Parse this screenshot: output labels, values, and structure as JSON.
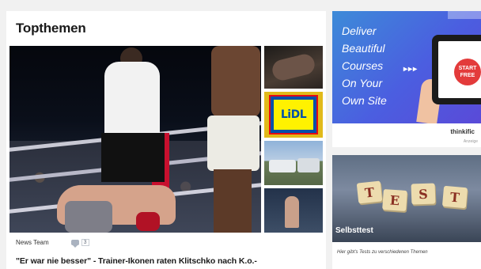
{
  "topthemen": {
    "title": "Topthemen",
    "meta": {
      "source": "News Team",
      "comments": "3"
    },
    "headline": "\"Er war nie besser\" - Trainer-Ikonen raten Klitschko nach K.o.-"
  },
  "thumbs": {
    "lidl_logo_text": "LiDL"
  },
  "ad": {
    "lines": [
      "Deliver",
      "Beautiful",
      "Courses",
      "On Your",
      "Own Site"
    ],
    "arrows": "▸▸▸",
    "button": [
      "START",
      "FREE"
    ],
    "brand": "thinkific",
    "sub": "Anzeige"
  },
  "card": {
    "tiles": [
      "T",
      "E",
      "S",
      "T"
    ],
    "label": "Selbsttest",
    "desc": "Hier gibt's Tests zu verschiedenen Themen"
  }
}
